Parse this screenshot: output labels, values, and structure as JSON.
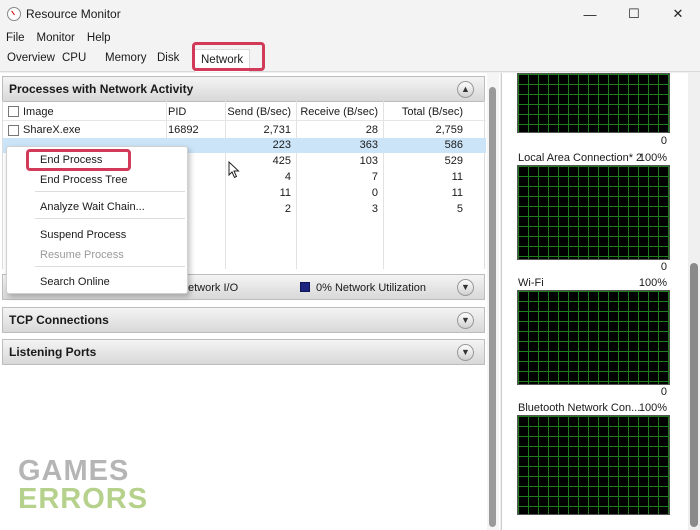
{
  "window": {
    "title": "Resource Monitor",
    "controls": {
      "minimize": "—",
      "maximize": "☐",
      "close": "✕"
    }
  },
  "menu": [
    "File",
    "Monitor",
    "Help"
  ],
  "tabs": [
    {
      "label": "Overview"
    },
    {
      "label": "CPU"
    },
    {
      "label": "Memory"
    },
    {
      "label": "Disk"
    },
    {
      "label": "Network",
      "active": true
    }
  ],
  "processes": {
    "title": "Processes with Network Activity",
    "columns": [
      "Image",
      "PID",
      "Send (B/sec)",
      "Receive (B/sec)",
      "Total (B/sec)"
    ],
    "rows": [
      {
        "image": "ShareX.exe",
        "pid": "16892",
        "send": "2,731",
        "receive": "28",
        "total": "2,759"
      },
      {
        "image": "",
        "pid": "",
        "send": "223",
        "receive": "363",
        "total": "586"
      },
      {
        "image": "",
        "pid": "",
        "send": "425",
        "receive": "103",
        "total": "529"
      },
      {
        "image": "",
        "pid": "",
        "send": "4",
        "receive": "7",
        "total": "11"
      },
      {
        "image": "",
        "pid": "",
        "send": "11",
        "receive": "0",
        "total": "11"
      },
      {
        "image": "",
        "pid": "",
        "send": "2",
        "receive": "3",
        "total": "5"
      }
    ]
  },
  "context_menu": {
    "items": [
      "End Process",
      "End Process Tree",
      "Analyze Wait Chain...",
      "Suspend Process",
      "Resume Process",
      "Search Online"
    ]
  },
  "network_activity": {
    "io_label": "etwork I/O",
    "utilization": "0% Network Utilization",
    "utilization_color": "#1a237e"
  },
  "tcp": {
    "title": "TCP Connections"
  },
  "listening": {
    "title": "Listening Ports"
  },
  "graphs": [
    {
      "label": "",
      "max": "",
      "min": "0"
    },
    {
      "label": "Local Area Connection* 2",
      "max": "100%",
      "min": "0"
    },
    {
      "label": "Wi-Fi",
      "max": "100%",
      "min": "0"
    },
    {
      "label": "Bluetooth Network Con...",
      "max": "100%",
      "min": ""
    }
  ],
  "watermark": {
    "line1": "GAMES",
    "line2": "ERRORS"
  },
  "colors": {
    "highlight": "#d23a5a",
    "graph_grid": "#1f7d1f",
    "selection": "#cce4f7"
  }
}
